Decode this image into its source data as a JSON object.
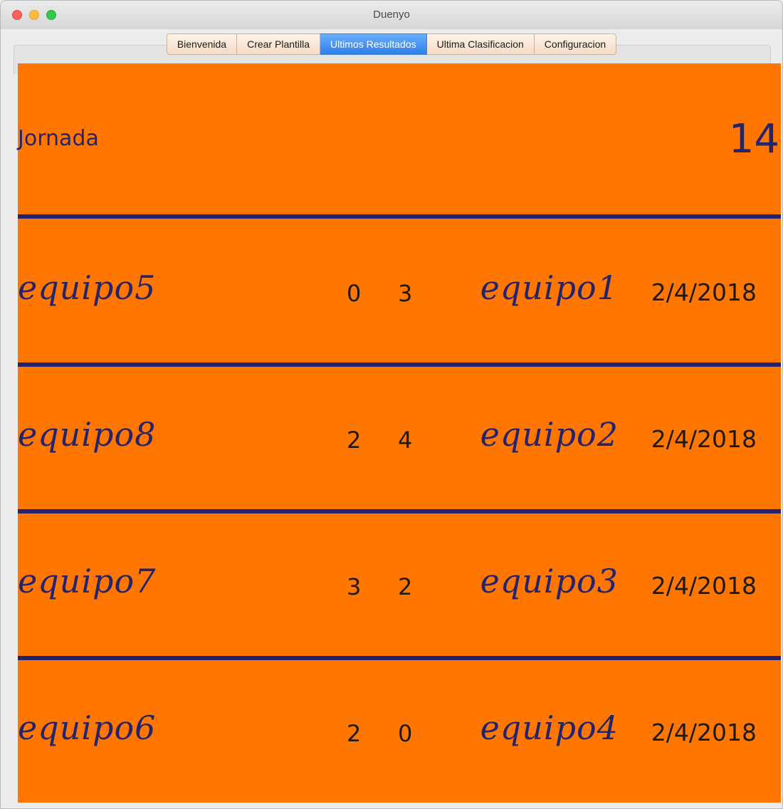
{
  "window": {
    "title": "Duenyo"
  },
  "tabs": [
    {
      "label": "Bienvenida"
    },
    {
      "label": "Crear Plantilla"
    },
    {
      "label": "Ultimos Resultados"
    },
    {
      "label": "Ultima Clasificacion"
    },
    {
      "label": "Configuracion"
    }
  ],
  "jornada": {
    "label": "Jornada",
    "number": "14"
  },
  "matches": [
    {
      "home": "equipo5",
      "home_score": "0",
      "away_score": "3",
      "away": "equipo1",
      "date": "2/4/2018"
    },
    {
      "home": "equipo8",
      "home_score": "2",
      "away_score": "4",
      "away": "equipo2",
      "date": "2/4/2018"
    },
    {
      "home": "equipo7",
      "home_score": "3",
      "away_score": "2",
      "away": "equipo3",
      "date": "2/4/2018"
    },
    {
      "home": "equipo6",
      "home_score": "2",
      "away_score": "0",
      "away": "equipo4",
      "date": "2/4/2018"
    }
  ],
  "colors": {
    "background": "#ff7700",
    "text": "#24246e",
    "divider": "#24246e",
    "selected_tab": "#2f7fe9"
  }
}
